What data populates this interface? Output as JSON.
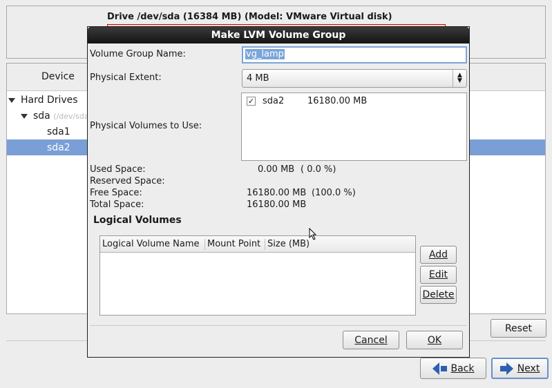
{
  "background": {
    "drive_title": "Drive /dev/sda (16384 MB) (Model: VMware Virtual disk)",
    "device_column": "Device",
    "tree": {
      "hard_drives": "Hard Drives",
      "sda": "sda",
      "sda_path": "(/dev/sda",
      "sda1": "sda1",
      "sda2": "sda2"
    },
    "reset_label": "Reset",
    "back_label": "Back",
    "next_label": "Next"
  },
  "dialog": {
    "title": "Make LVM Volume Group",
    "vg_name_label": "Volume Group Name:",
    "vg_name_value": "vg_lamp",
    "pe_label": "Physical Extent:",
    "pe_value": "4 MB",
    "pv_label": "Physical Volumes to Use:",
    "pv_items": [
      {
        "name": "sda2",
        "size": "16180.00 MB",
        "checked": true
      }
    ],
    "stats": {
      "used_label": "Used Space:",
      "used_value": "0.00 MB",
      "used_pct": "( 0.0 %)",
      "reserved_label": "Reserved Space:",
      "free_label": "Free Space:",
      "free_value": "16180.00 MB",
      "free_pct": "(100.0 %)",
      "total_label": "Total Space:",
      "total_value": "16180.00 MB"
    },
    "lv_section": "Logical Volumes",
    "lv_columns": [
      "Logical Volume Name",
      "Mount Point",
      "Size (MB)"
    ],
    "add_label": "Add",
    "edit_label": "Edit",
    "delete_label": "Delete",
    "cancel_label": "Cancel",
    "ok_label": "OK"
  }
}
